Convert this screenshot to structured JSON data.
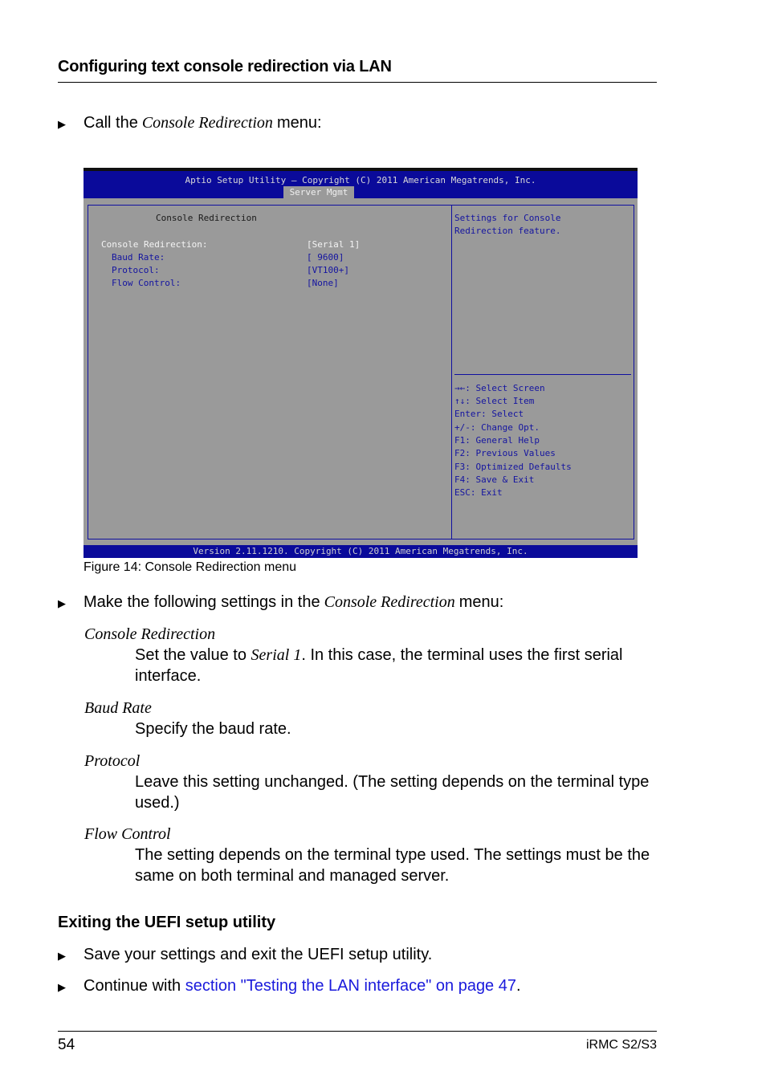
{
  "header": {
    "section_title": "Configuring text console redirection via LAN"
  },
  "step1": {
    "prefix": "Call the ",
    "menu_name": "Console Redirection",
    "suffix": " menu:"
  },
  "bios": {
    "title": "Aptio Setup Utility – Copyright (C) 2011 American Megatrends, Inc.",
    "active_tab": "Server Mgmt",
    "panel_heading": "Console Redirection",
    "settings": [
      {
        "label": "Console Redirection:",
        "value": "[Serial 1]"
      },
      {
        "label": "Baud Rate:",
        "value": "[ 9600]"
      },
      {
        "label": "Protocol:",
        "value": "[VT100+]"
      },
      {
        "label": "Flow Control:",
        "value": "[None]"
      }
    ],
    "help_text": [
      "Settings for Console",
      "Redirection feature."
    ],
    "key_help": [
      "→←: Select Screen",
      "↑↓: Select Item",
      "Enter: Select",
      "+/-: Change Opt.",
      "F1: General Help",
      "F2: Previous Values",
      "F3: Optimized Defaults",
      "F4: Save & Exit",
      "ESC: Exit"
    ],
    "footer": "Version 2.11.1210. Copyright (C) 2011 American Megatrends, Inc.",
    "colors": {
      "header_bg": "#0a0a9a",
      "panel_bg": "#9a9a9a",
      "highlight_text": "#1414a0"
    }
  },
  "figure_caption": "Figure 14: Console Redirection menu",
  "step2": {
    "prefix": "Make the following settings in the ",
    "menu_name": "Console Redirection",
    "suffix": " menu:"
  },
  "definitions": [
    {
      "term": "Console Redirection",
      "desc_prefix": "Set the value to ",
      "desc_italic": "Serial 1",
      "desc_suffix": ". In this case, the terminal uses the first serial interface."
    },
    {
      "term": "Baud Rate",
      "desc": "Specify the baud rate."
    },
    {
      "term": "Protocol",
      "desc": "Leave this setting unchanged. (The setting depends on the terminal type used.)"
    },
    {
      "term": "Flow Control",
      "desc": "The setting depends on the terminal type used. The settings must be the same on both terminal and managed server."
    }
  ],
  "exit_section": {
    "title": "Exiting the UEFI setup utility",
    "step1": "Save your settings and exit the UEFI setup utility.",
    "step2_prefix": "Continue with ",
    "step2_link": "section \"Testing the LAN interface\" on page 47",
    "step2_suffix": "."
  },
  "bullet_glyph": "▶",
  "footer": {
    "page_number": "54",
    "doc_name": "iRMC S2/S3"
  }
}
